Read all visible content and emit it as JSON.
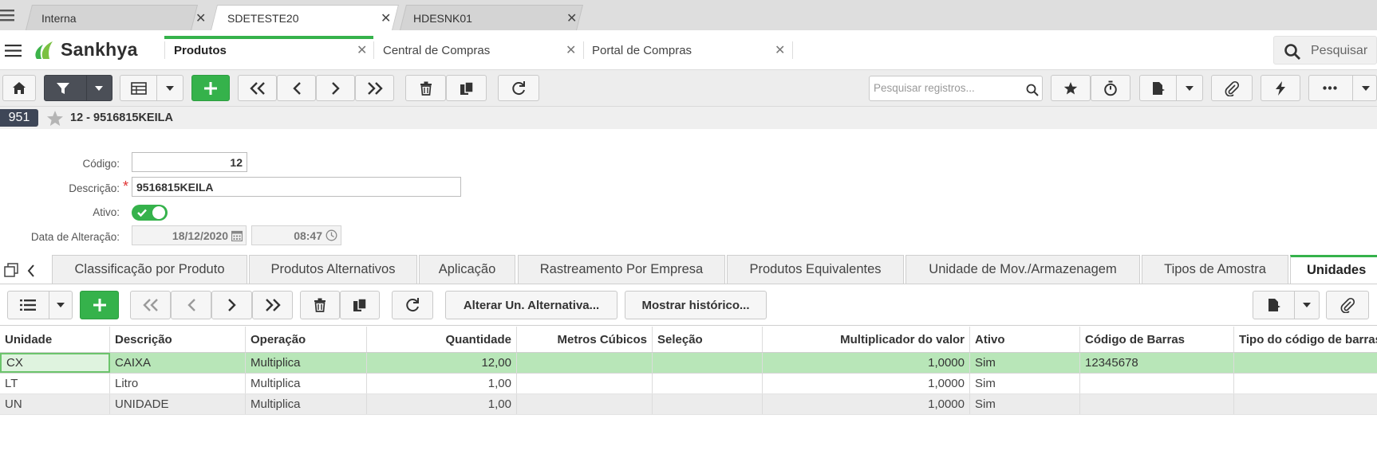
{
  "browser_tabs": [
    {
      "label": "Interna"
    },
    {
      "label": "SDETESTE20"
    },
    {
      "label": "HDESNK01"
    }
  ],
  "close_glyph": "✕",
  "brand": {
    "name": "Sankhya"
  },
  "app_tabs": [
    {
      "label": "Produtos"
    },
    {
      "label": "Central de Compras"
    },
    {
      "label": "Portal de Compras"
    }
  ],
  "global_search": {
    "placeholder": "Pesquisar"
  },
  "toolbar": {
    "search_placeholder": "Pesquisar registros..."
  },
  "record": {
    "number": "951",
    "title": "12 - 9516815KEILA"
  },
  "form": {
    "codigo_label": "Código:",
    "codigo_value": "12",
    "descricao_label": "Descrição:",
    "required_mark": "*",
    "descricao_value": "9516815KEILA",
    "ativo_label": "Ativo:",
    "data_alt_label": "Data de Alteração:",
    "data_alt_date": "18/12/2020",
    "data_alt_time": "08:47"
  },
  "detail_tabs": [
    {
      "label": "Classificação por Produto"
    },
    {
      "label": "Produtos Alternativos"
    },
    {
      "label": "Aplicação"
    },
    {
      "label": "Rastreamento Por Empresa"
    },
    {
      "label": "Produtos Equivalentes"
    },
    {
      "label": "Unidade de Mov./Armazenagem"
    },
    {
      "label": "Tipos de Amostra"
    },
    {
      "label": "Unidades"
    }
  ],
  "grid_toolbar": {
    "alterar_label": "Alterar Un. Alternativa...",
    "historico_label": "Mostrar histórico..."
  },
  "grid": {
    "columns": [
      "Unidade",
      "Descrição",
      "Operação",
      "Quantidade",
      "Metros Cúbicos",
      "Seleção",
      "Multiplicador do valor",
      "Ativo",
      "Código de Barras",
      "Tipo do código de barras"
    ],
    "rows": [
      [
        "CX",
        "CAIXA",
        "Multiplica",
        "12,00",
        "",
        "",
        "1,0000",
        "Sim",
        "12345678",
        ""
      ],
      [
        "LT",
        "Litro",
        "Multiplica",
        "1,00",
        "",
        "",
        "1,0000",
        "Sim",
        "",
        ""
      ],
      [
        "UN",
        "UNIDADE",
        "Multiplica",
        "1,00",
        "",
        "",
        "1,0000",
        "Sim",
        "",
        ""
      ]
    ]
  },
  "colors": {
    "accent": "#35b24b",
    "selected_row": "#b8e6b8",
    "toolbar_dark": "#4b4f57"
  }
}
